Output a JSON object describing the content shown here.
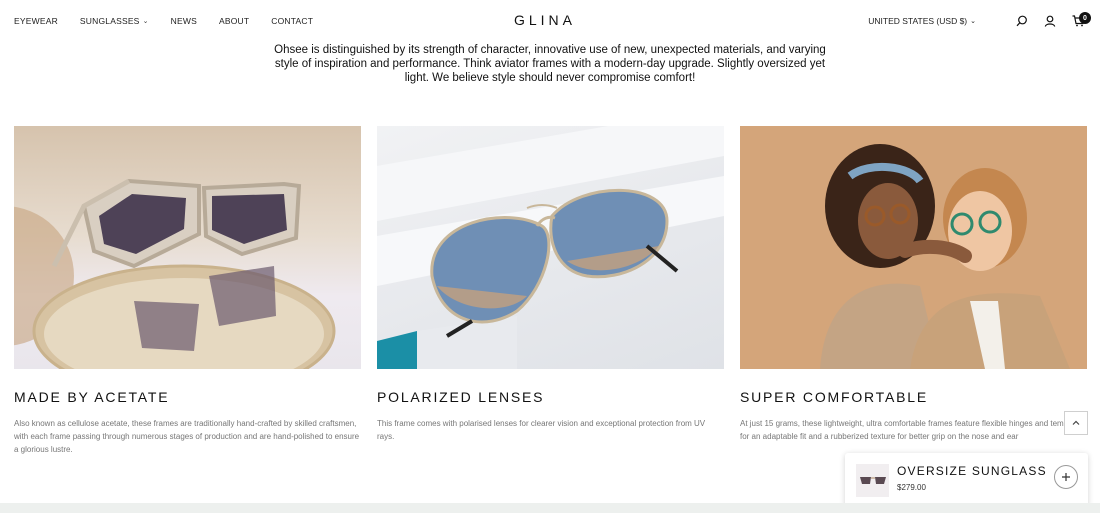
{
  "header": {
    "nav": [
      {
        "label": "EYEWEAR"
      },
      {
        "label": "SUNGLASSES"
      },
      {
        "label": "NEWS"
      },
      {
        "label": "ABOUT"
      },
      {
        "label": "CONTACT"
      }
    ],
    "logo": "GLINA",
    "currency": "UNITED STATES (USD $)",
    "cart_count": "0"
  },
  "intro": {
    "line1": "Ohsee is distinguished by its strength of character, innovative use of new, unexpected materials, and varying",
    "line2": "style of inspiration and performance.   Think aviator frames with a modern-day upgrade. Slightly oversized yet",
    "line3": "light.   We believe style should never compromise comfort!"
  },
  "features": [
    {
      "title": "MADE BY ACETATE",
      "text": "Also known as cellulose acetate, these frames are traditionally hand-crafted by  skilled craftsmen, with each frame passing through numerous stages of production   and are hand-polished to ensure a glorious lustre."
    },
    {
      "title": "POLARIZED LENSES",
      "text": "This frame comes with polarised lenses for clearer vision and exceptional   protection from UV rays."
    },
    {
      "title": "SUPER COMFORTABLE",
      "text": "At just 15 grams, these lightweight, ultra comfortable frames feature flexible  hinges and temples for an adaptable fit and a rubberized texture for better grip on   the nose and ear"
    }
  ],
  "sticky_cart": {
    "name": "OVERSIZE SUNGLASS",
    "price": "$279.00"
  },
  "colors": {
    "text": "#111111",
    "muted": "#777777",
    "tan": "#d4a57a"
  }
}
